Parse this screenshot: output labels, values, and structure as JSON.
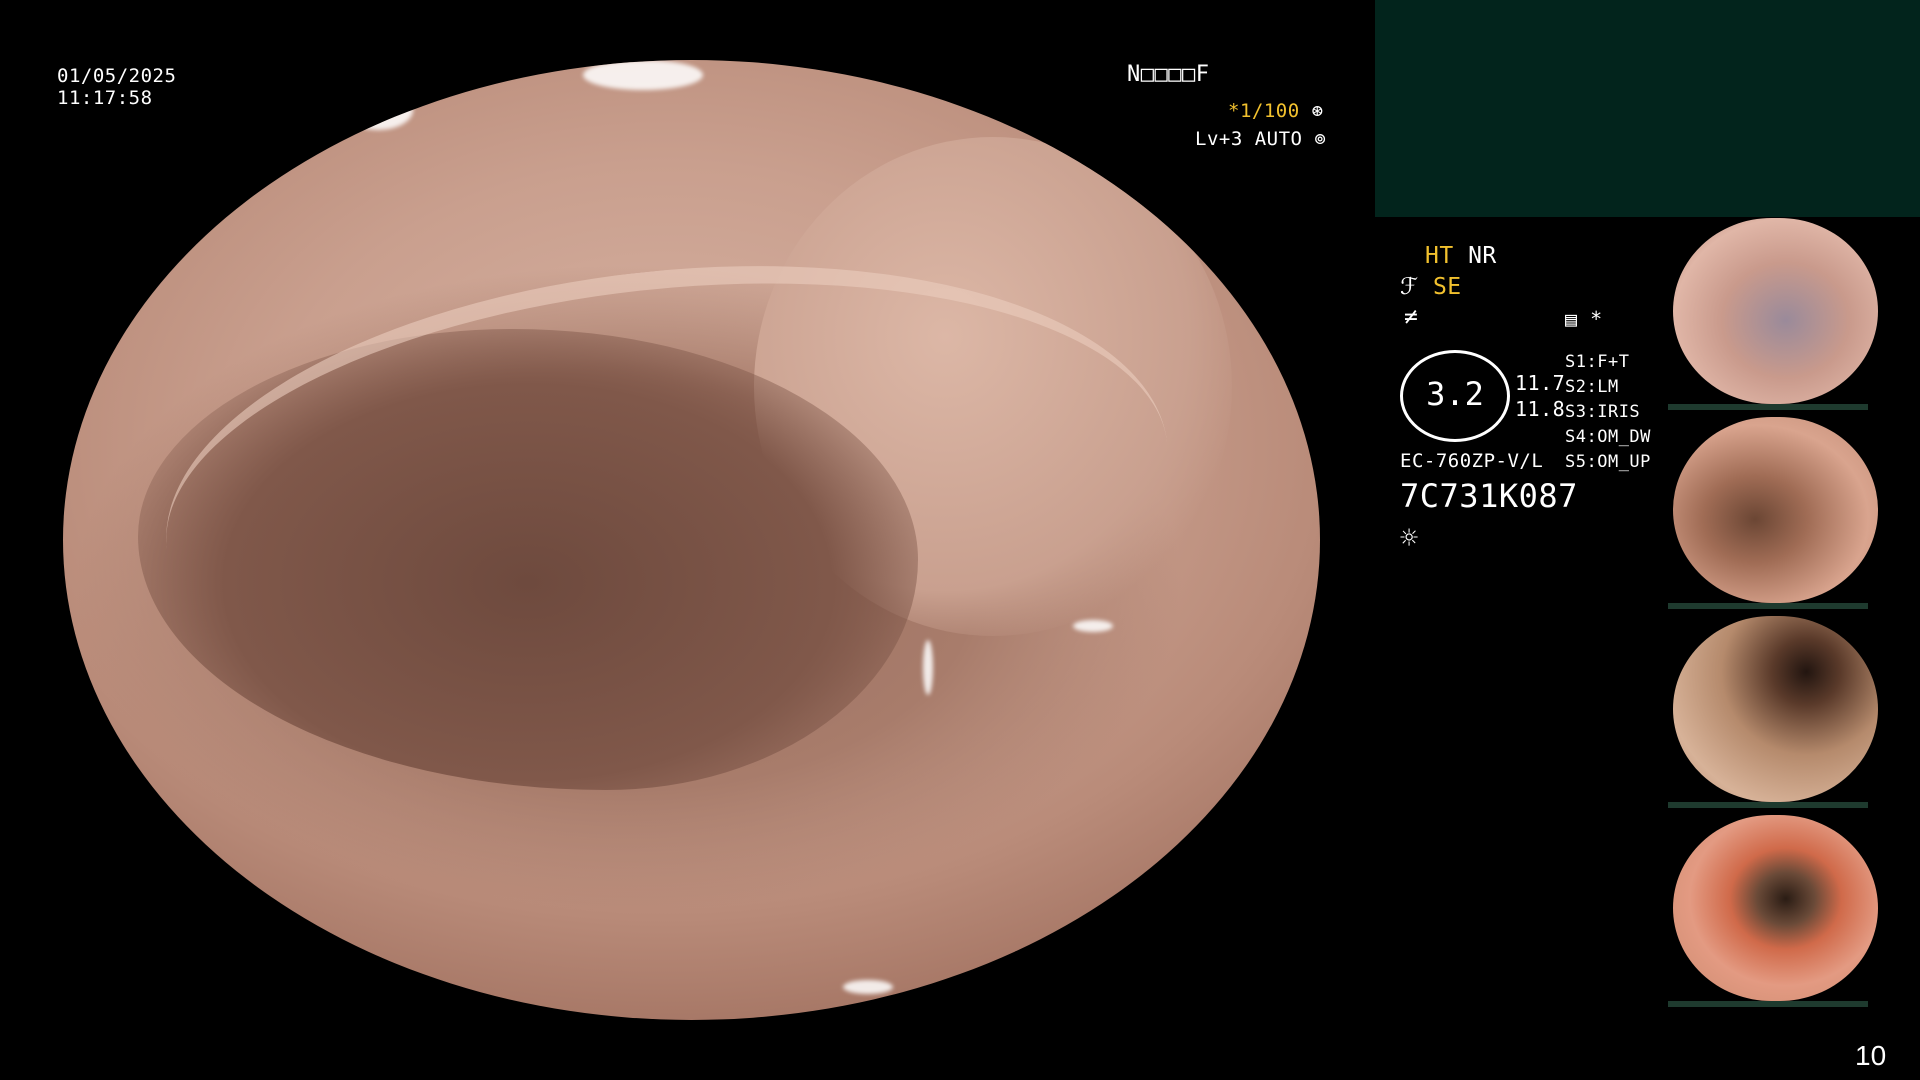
{
  "osd": {
    "date": "01/05/2025",
    "time": "11:17:58",
    "patient_id": "N□□□□F",
    "shutter": "*1/100",
    "level": "Lv+3 AUTO"
  },
  "side_panel": {
    "ht": "HT",
    "nr": "NR",
    "se": "SE",
    "meter_value": "3.2",
    "meter_side_top": "11.7",
    "meter_side_bottom": "11.8",
    "scope_model": "EC-760ZP-V/L",
    "scope_serial": "7C731K087",
    "asterisk": "*",
    "shortcuts": [
      {
        "key": "S1:",
        "value": "F+T"
      },
      {
        "key": "S2:",
        "value": "LM"
      },
      {
        "key": "S3:",
        "value": "IRIS"
      },
      {
        "key": "S4:",
        "value": "OM_DW"
      },
      {
        "key": "S5:",
        "value": "OM_UP"
      }
    ]
  },
  "page_number": "10",
  "colors": {
    "osd_yellow": "#f2c12e",
    "top_box": "#02241c"
  },
  "icons": [
    "shutter-icon",
    "auto-icon",
    "structure-icon",
    "color-icon",
    "record-icon",
    "light-icon"
  ]
}
